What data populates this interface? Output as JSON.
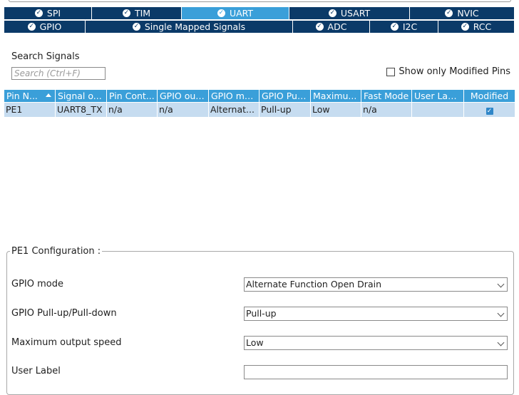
{
  "tabs_row1": [
    {
      "label": "SPI",
      "active": false
    },
    {
      "label": "TIM",
      "active": false
    },
    {
      "label": "UART",
      "active": true
    },
    {
      "label": "USART",
      "active": false
    },
    {
      "label": "NVIC",
      "active": false
    }
  ],
  "tabs_row2": [
    {
      "label": "GPIO",
      "active": false
    },
    {
      "label": "Single Mapped Signals",
      "active": false
    },
    {
      "label": "ADC",
      "active": false
    },
    {
      "label": "I2C",
      "active": false
    },
    {
      "label": "RCC",
      "active": false
    }
  ],
  "search": {
    "label": "Search Signals",
    "placeholder": "Search (Ctrl+F)"
  },
  "filter": {
    "show_modified_label": "Show only Modified Pins",
    "checked": false
  },
  "table": {
    "columns": [
      "Pin N...",
      "Signal o...",
      "Pin Cont...",
      "GPIO out...",
      "GPIO mo...",
      "GPIO Pull...",
      "Maximu...",
      "Fast Mode",
      "User Label",
      "Modified"
    ],
    "rows": [
      {
        "cells": [
          "PE1",
          "UART8_TX",
          "n/a",
          "n/a",
          "Alternat...",
          "Pull-up",
          "Low",
          "n/a",
          ""
        ],
        "modified": true
      }
    ]
  },
  "config": {
    "title": "PE1 Configuration :",
    "fields": [
      {
        "label": "GPIO mode",
        "value": "Alternate Function Open Drain"
      },
      {
        "label": "GPIO Pull-up/Pull-down",
        "value": "Pull-up"
      },
      {
        "label": "Maximum output speed",
        "value": "Low"
      },
      {
        "label": "User Label",
        "value": ""
      }
    ]
  },
  "colors": {
    "tab_bg": "#0b3a68",
    "tab_active": "#3a9fd9",
    "header_bg": "#3a9fd9",
    "row_selected": "#c6dcf0"
  }
}
